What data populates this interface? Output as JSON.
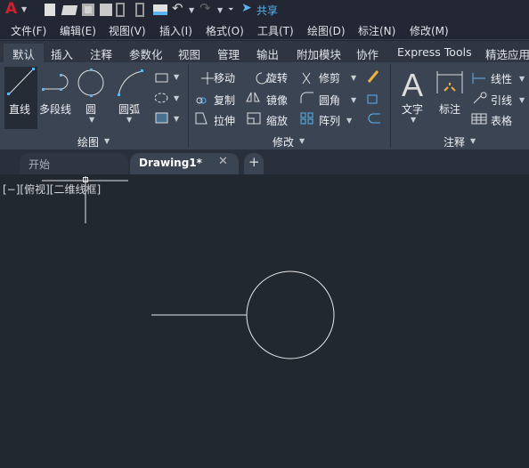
{
  "quick_access": {
    "share_label": "共享",
    "icons": [
      "autocad-logo",
      "new-icon",
      "open-icon",
      "save-icon",
      "save-as-icon",
      "open-from-web-icon",
      "save-to-web-icon",
      "print-icon",
      "undo-icon",
      "redo-icon",
      "customize-icon",
      "share-icon"
    ]
  },
  "menu": [
    "文件(F)",
    "编辑(E)",
    "视图(V)",
    "插入(I)",
    "格式(O)",
    "工具(T)",
    "绘图(D)",
    "标注(N)",
    "修改(M)"
  ],
  "ribbon_tabs": [
    "默认",
    "插入",
    "注释",
    "参数化",
    "视图",
    "管理",
    "输出",
    "附加模块",
    "协作",
    "Express Tools",
    "精选应用"
  ],
  "draw_panel": {
    "title": "绘图",
    "line": "直线",
    "polyline": "多段线",
    "circle": "圆",
    "arc": "圆弧"
  },
  "modify_panel": {
    "title": "修改",
    "move": "移动",
    "rotate": "旋转",
    "trim": "修剪",
    "copy": "复制",
    "mirror": "镜像",
    "fillet": "圆角",
    "stretch": "拉伸",
    "scale": "缩放",
    "array": "阵列"
  },
  "annotation_panel": {
    "title": "注释",
    "text": "文字",
    "dimension": "标注",
    "linear": "线性",
    "leader": "引线",
    "table": "表格"
  },
  "doc_tabs": {
    "start": "开始",
    "drawing": "Drawing1*"
  },
  "viewport_label": "[−][俯视][二维线框]",
  "colors": {
    "accent": "#5ab4f0",
    "ribbon": "#3b4453",
    "canvas": "#212830"
  }
}
